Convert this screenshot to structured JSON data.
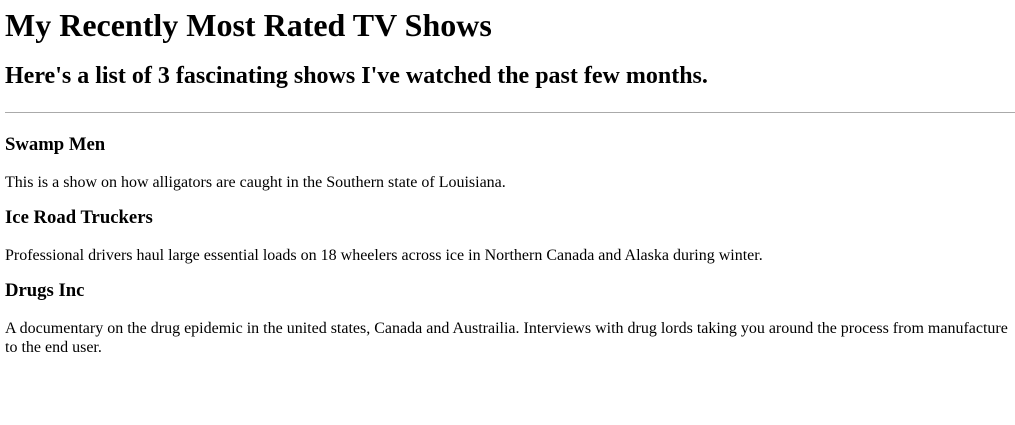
{
  "page": {
    "title": "My Recently Most Rated TV Shows",
    "subtitle": "Here's a list of 3 fascinating shows I've watched the past few months."
  },
  "shows": [
    {
      "title": "Swamp Men",
      "description": "This is a show on how alligators are caught in the Southern state of Louisiana."
    },
    {
      "title": "Ice Road Truckers",
      "description": "Professional drivers haul large essential loads on 18 wheelers across ice in Northern Canada and Alaska during winter."
    },
    {
      "title": "Drugs Inc",
      "description": "A documentary on the drug epidemic in the united states, Canada and Austrailia. Interviews with drug lords taking you around the process from manufacture to the end user."
    }
  ]
}
